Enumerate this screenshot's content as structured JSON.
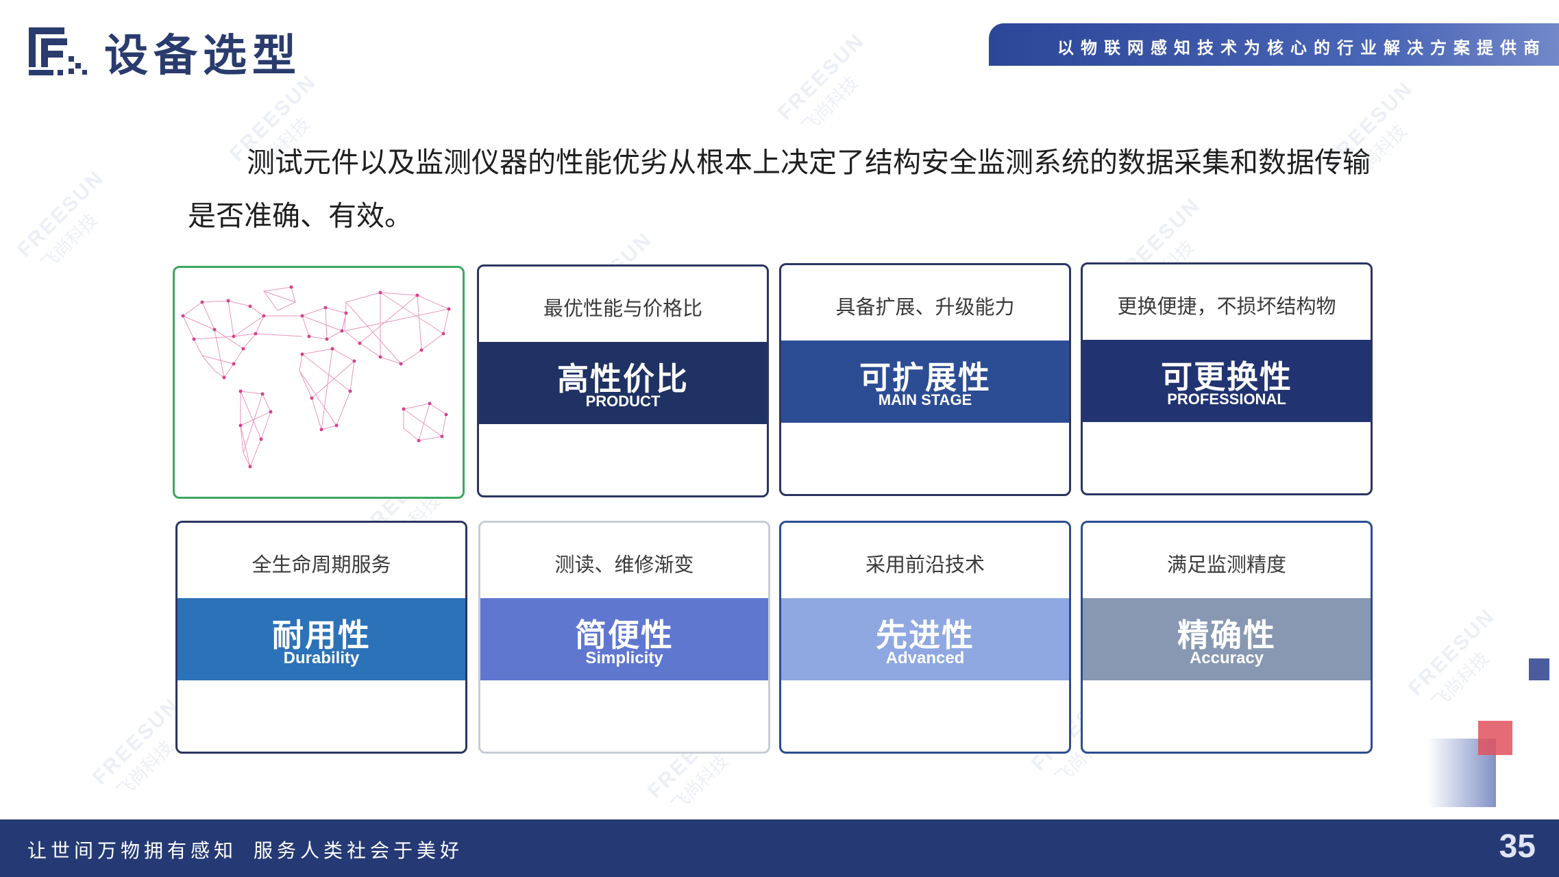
{
  "header": {
    "title": "设备选型",
    "banner_text": "以物联网感知技术为核心的行业解决方案提供商"
  },
  "intro": {
    "text": "测试元件以及监测仪器的性能优劣从根本上决定了结构安全监测系统的数据采集和数据传输是否准确、有效。"
  },
  "cards": [
    {
      "subtitle": "最优性能与价格比",
      "title": "高性价比",
      "english": "PRODUCT",
      "color": "#1f3263"
    },
    {
      "subtitle": "具备扩展、升级能力",
      "title": "可扩展性",
      "english": "MAIN STAGE",
      "color": "#2c4c94"
    },
    {
      "subtitle": "更换便捷，不损坏结构物",
      "title": "可更换性",
      "english": "PROFESSIONAL",
      "color": "#213370"
    },
    {
      "subtitle": "全生命周期服务",
      "title": "耐用性",
      "english": "Durability",
      "color": "#2c72b8"
    },
    {
      "subtitle": "测读、维修渐变",
      "title": "简便性",
      "english": "Simplicity",
      "color": "#6077d0"
    },
    {
      "subtitle": "采用前沿技术",
      "title": "先进性",
      "english": "Advanced",
      "color": "#8fa8e2"
    },
    {
      "subtitle": "满足监测精度",
      "title": "精确性",
      "english": "Accuracy",
      "color": "#8898b3"
    }
  ],
  "watermark": {
    "en": "FREESUN",
    "cn": "飞尚科技"
  },
  "footer": {
    "slogan_left": "让世间万物拥有感知",
    "slogan_right": "服务人类社会于美好",
    "page_number": "35"
  },
  "colors": {
    "brand_dark": "#253a74",
    "title": "#2a3b6e",
    "map_card_border": "#3aa860",
    "map_network": "#d6428a",
    "deco_red": "#e0525f",
    "deco_blue": "#3f5296"
  },
  "icons": [
    "freesun-logo-icon",
    "world-map-network-icon"
  ]
}
